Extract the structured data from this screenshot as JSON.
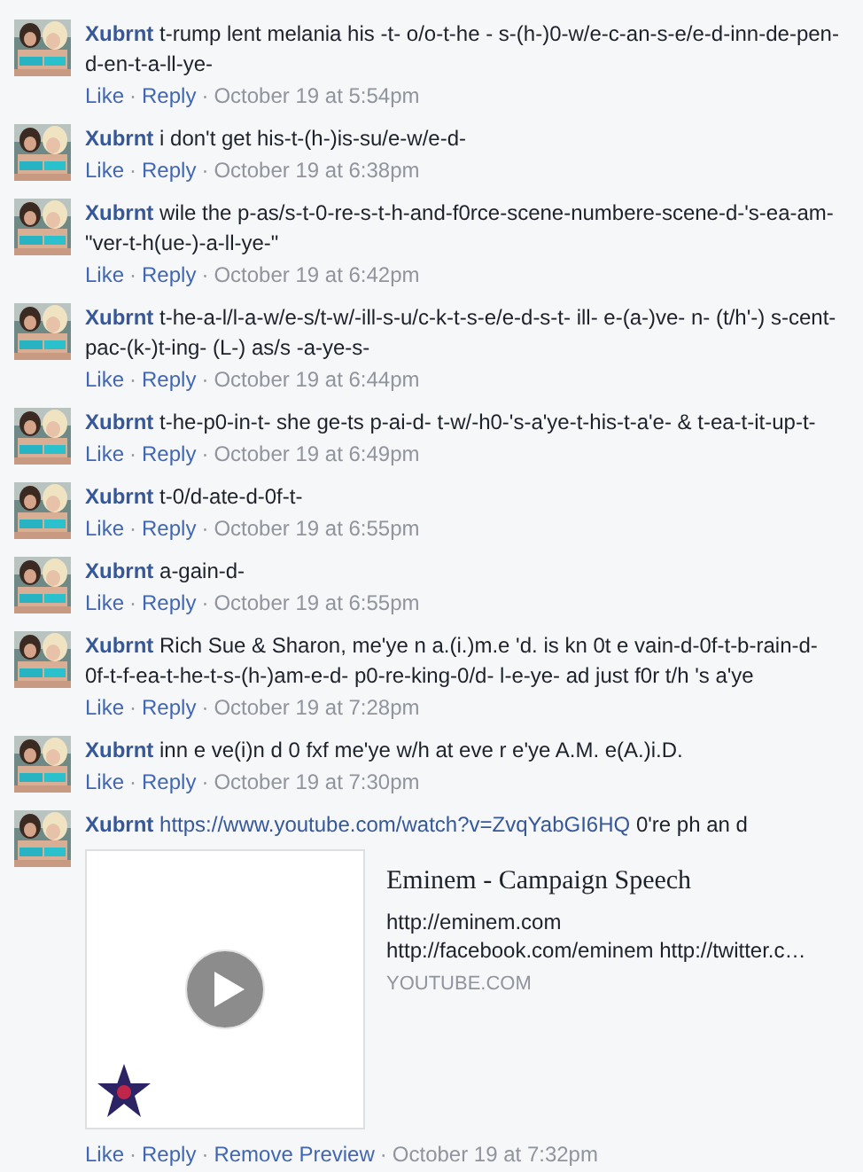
{
  "separator": "·",
  "comments": [
    {
      "author": "Xubrnt",
      "text": "t-rump lent melania his -t- o/o-t-he - s-(h-)0-w/e-c-an-s-e/e-d-inn-de-pen-d-en-t-a-ll-ye-",
      "actions": [
        "Like",
        "Reply"
      ],
      "time": "October 19 at 5:54pm"
    },
    {
      "author": "Xubrnt",
      "text": "i don't get his-t-(h-)is-su/e-w/e-d-",
      "actions": [
        "Like",
        "Reply"
      ],
      "time": "October 19 at 6:38pm"
    },
    {
      "author": "Xubrnt",
      "text": "wile the p-as/s-t-0-re-s-t-h-and-f0rce-scene-numbere-scene-d-'s-ea-am-\"ver-t-h(ue-)-a-ll-ye-\"",
      "actions": [
        "Like",
        "Reply"
      ],
      "time": "October 19 at 6:42pm"
    },
    {
      "author": "Xubrnt",
      "text": "t-he-a-l/l-a-w/e-s/t-w/-ill-s-u/c-k-t-s-e/e-d-s-t- ill- e-(a-)ve- n- (t/h'-) s-cent-pac-(k-)t-ing- (L-) as/s -a-ye-s-",
      "actions": [
        "Like",
        "Reply"
      ],
      "time": "October 19 at 6:44pm"
    },
    {
      "author": "Xubrnt",
      "text": "t-he-p0-in-t- she ge-ts p-ai-d- t-w/-h0-'s-a'ye-t-his-t-a'e- & t-ea-t-it-up-t-",
      "actions": [
        "Like",
        "Reply"
      ],
      "time": "October 19 at 6:49pm"
    },
    {
      "author": "Xubrnt",
      "text": "t-0/d-ate-d-0f-t-",
      "actions": [
        "Like",
        "Reply"
      ],
      "time": "October 19 at 6:55pm"
    },
    {
      "author": "Xubrnt",
      "text": "a-gain-d-",
      "actions": [
        "Like",
        "Reply"
      ],
      "time": "October 19 at 6:55pm"
    },
    {
      "author": "Xubrnt",
      "text": "Rich Sue & Sharon, me'ye n a.(i.)m.e 'd. is kn 0t e vain-d-0f-t-b-rain-d-0f-t-f-ea-t-he-t-s-(h-)am-e-d- p0-re-king-0/d- l-e-ye- ad just f0r t/h 's a'ye",
      "actions": [
        "Like",
        "Reply"
      ],
      "time": "October 19 at 7:28pm"
    },
    {
      "author": "Xubrnt",
      "text": "inn e ve(i)n d 0 fxf me'ye w/h at eve r e'ye A.M. e(A.)i.D.",
      "actions": [
        "Like",
        "Reply"
      ],
      "time": "October 19 at 7:30pm"
    },
    {
      "author": "Xubrnt",
      "link": "https://www.youtube.com/watch?v=ZvqYabGI6HQ",
      "text": "0're ph an d",
      "preview": {
        "title": "Eminem - Campaign Speech",
        "description": [
          "http://eminem.com",
          "http://facebook.com/eminem http://twitter.c…"
        ],
        "domain": "YOUTUBE.COM"
      },
      "actions": [
        "Like",
        "Reply",
        "Remove Preview"
      ],
      "time": "October 19 at 7:32pm"
    }
  ]
}
